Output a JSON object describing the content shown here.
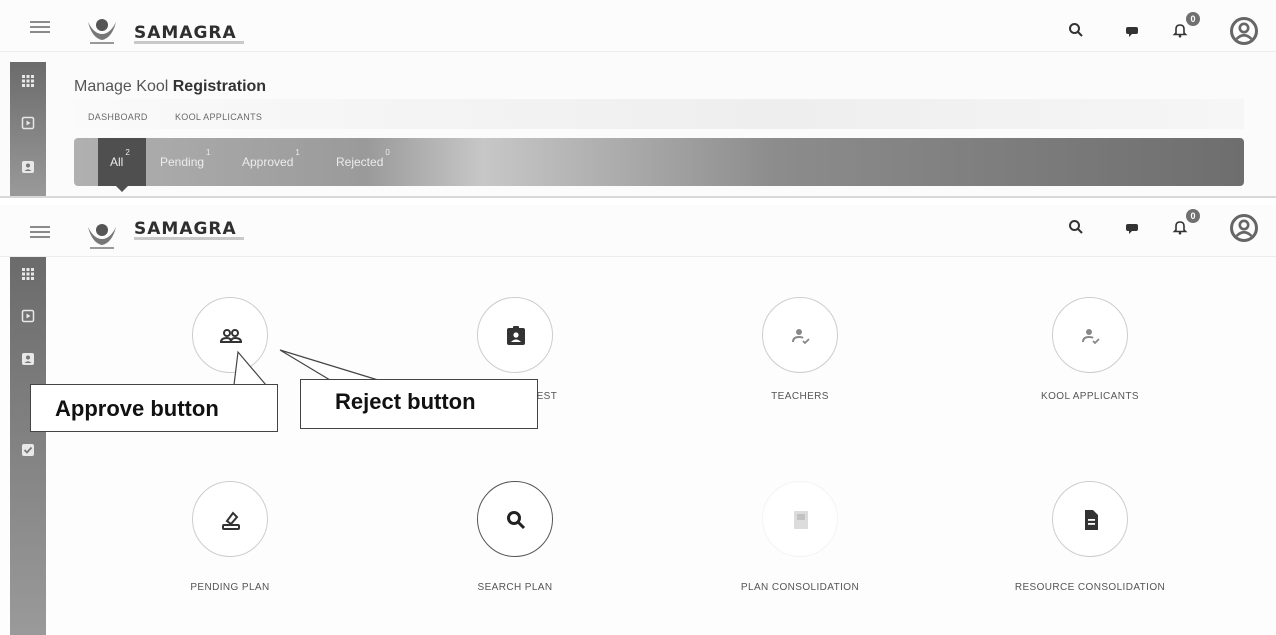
{
  "brand": {
    "name": "SAMAGRA",
    "logo_icon": "samagra-logo-icon"
  },
  "header_icons": [
    "search-icon",
    "chat-icon",
    "bell-icon",
    "account-icon"
  ],
  "notification_count": "0",
  "top_screen": {
    "page_title_light": "Manage Kool ",
    "page_title_bold": "Registration",
    "breadcrumbs": [
      "DASHBOARD",
      "KOOL APPLICANTS"
    ],
    "tabs": [
      {
        "label": "All",
        "count": "2"
      },
      {
        "label": "Pending",
        "count": "1"
      },
      {
        "label": "Approved",
        "count": "1"
      },
      {
        "label": "Rejected",
        "count": "0"
      }
    ]
  },
  "dashboard": {
    "tiles": [
      {
        "label": "",
        "icon": "group-icon"
      },
      {
        "label": "QUEST",
        "icon": "badge-icon"
      },
      {
        "label": "TEACHERS",
        "icon": "teacher-icon"
      },
      {
        "label": "KOOL APPLICANTS",
        "icon": "applicant-icon"
      },
      {
        "label": "PENDING PLAN",
        "icon": "pending-plan-icon"
      },
      {
        "label": "SEARCH PLAN",
        "icon": "search-plan-icon"
      },
      {
        "label": "PLAN CONSOLIDATION",
        "icon": "plan-consolidation-icon"
      },
      {
        "label": "RESOURCE CONSOLIDATION",
        "icon": "document-icon"
      }
    ]
  },
  "annotations": {
    "approve": "Approve button",
    "reject": "Reject button"
  },
  "colors": {
    "tab_active": "#4f4f4f",
    "tab_bar_end": "#6e6e6e",
    "sidebar": "#7a7a7a"
  }
}
